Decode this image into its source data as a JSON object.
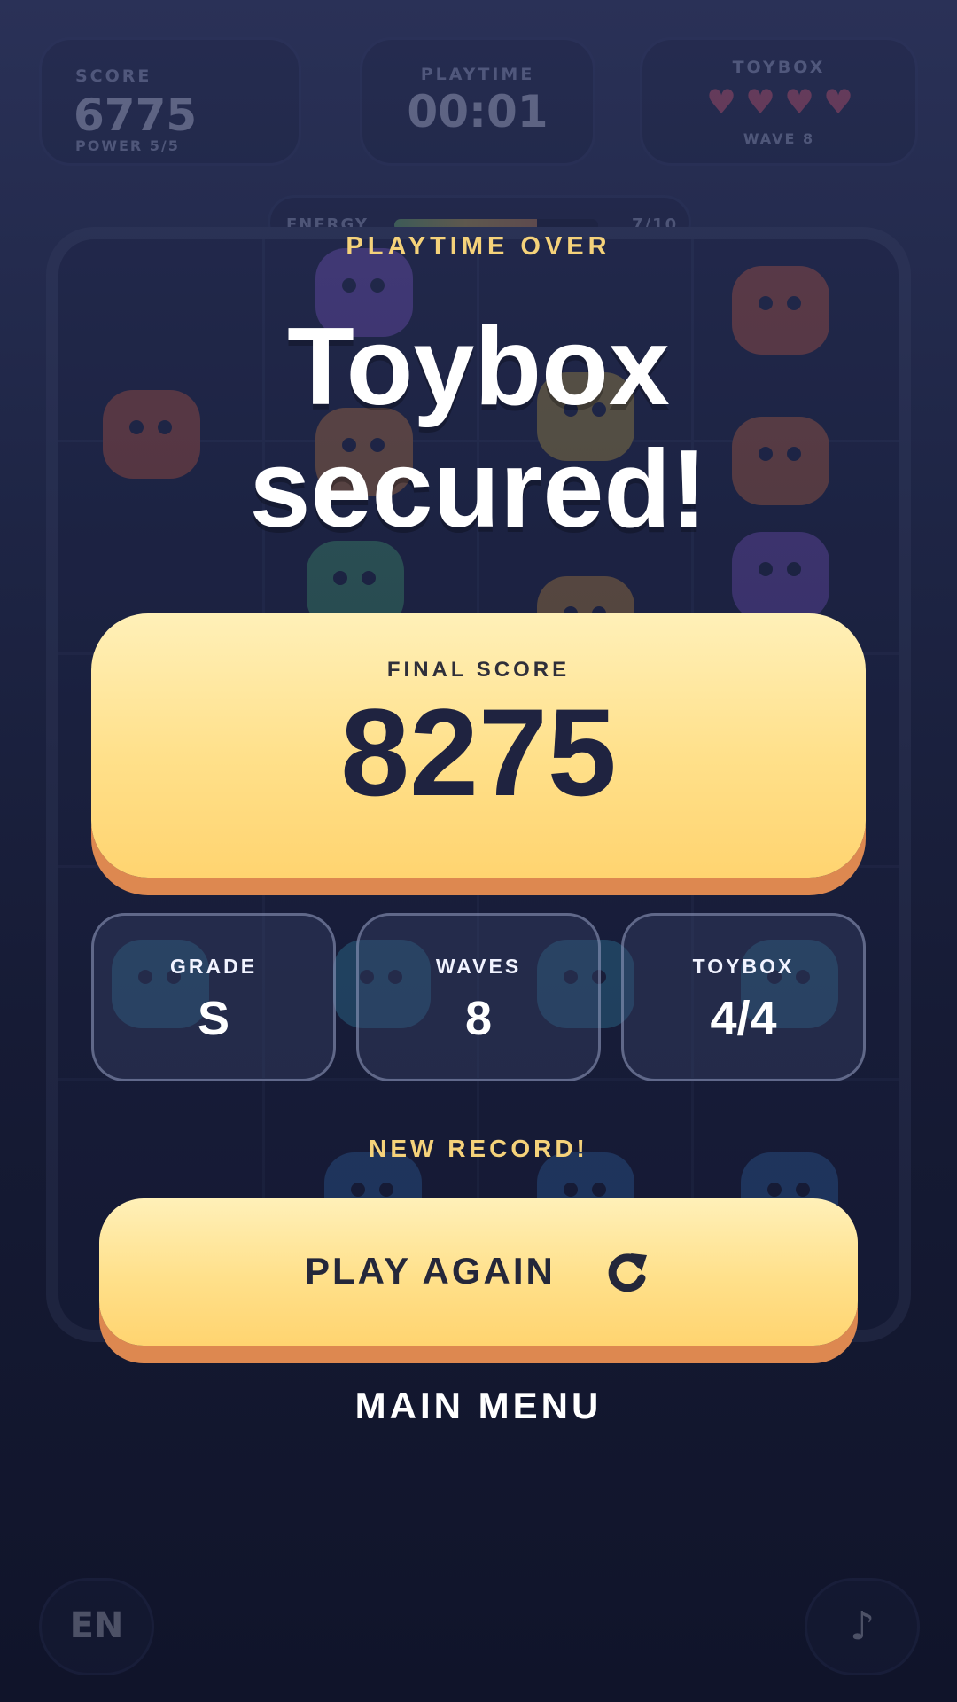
{
  "hud": {
    "score_label": "SCORE",
    "score_value": "6775",
    "power_text": "POWER 5/5",
    "playtime_label": "PLAYTIME",
    "playtime_value": "00:01",
    "toybox_label": "TOYBOX",
    "hearts": 4,
    "wave_text": "WAVE 8",
    "energy_label": "ENERGY",
    "energy_value": "7/10",
    "energy_fraction": 0.7
  },
  "footer": {
    "language_label": "EN"
  },
  "result": {
    "eyebrow": "PLAYTIME OVER",
    "headline_line1": "Toybox",
    "headline_line2": "secured!",
    "final_score_label": "FINAL SCORE",
    "final_score_value": "8275",
    "stats": [
      {
        "label": "GRADE",
        "value": "S"
      },
      {
        "label": "WAVES",
        "value": "8"
      },
      {
        "label": "TOYBOX",
        "value": "4/4"
      }
    ],
    "record_text": "NEW RECORD!",
    "play_again_label": "PLAY AGAIN",
    "main_menu_label": "MAIN MENU"
  },
  "colors": {
    "accent_yellow": "#ffe08a",
    "accent_shadow": "#dd8850",
    "eyebrow_gold": "#f5d27a",
    "background_dark": "#161b35",
    "heart_red": "#ff5a6e"
  },
  "icons": {
    "play_again": "refresh-icon",
    "sound": "music-note-icon",
    "hearts": "heart-icon"
  }
}
